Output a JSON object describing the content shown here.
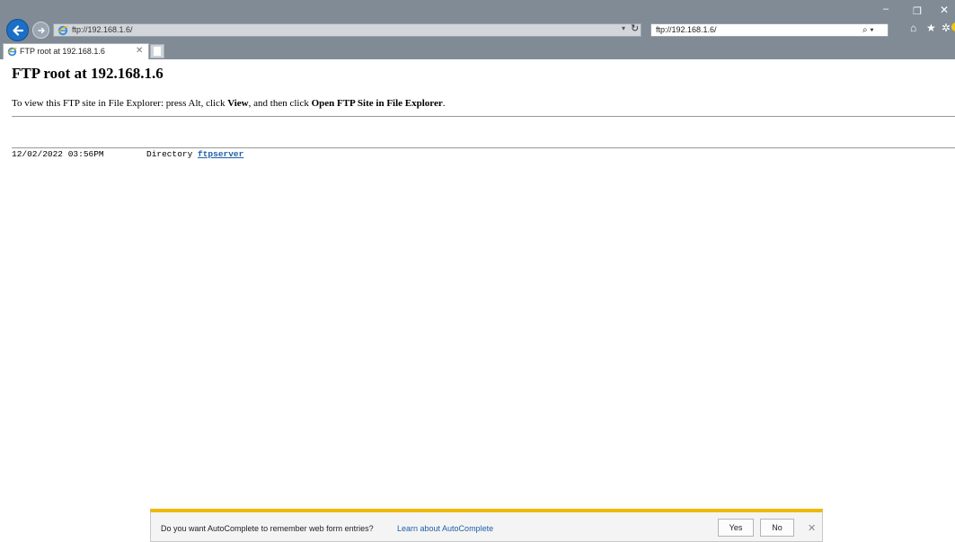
{
  "window": {
    "minimize_glyph": "–",
    "restore_glyph": "❐",
    "close_glyph": "✕"
  },
  "toolbar": {
    "address_url": "ftp://192.168.1.6/",
    "secondary_url": "ftp://192.168.1.6/",
    "search_glyph": "⌕ ▾",
    "dropdown_glyph": "▾",
    "refresh_glyph": "↻",
    "icons": [
      "back-icon",
      "forward-icon",
      "home-icon",
      "star-icon",
      "gear-icon",
      "smiley-icon"
    ],
    "home_glyph": "⌂",
    "star_glyph": "★",
    "gear_glyph": "✲"
  },
  "tab": {
    "title": "FTP root at 192.168.1.6",
    "close_glyph": "✕"
  },
  "page": {
    "title": "FTP root at 192.168.1.6",
    "instructions": {
      "part1": "To view this FTP site in File Explorer: press Alt, click ",
      "view": "View",
      "part2": ", and then click ",
      "open": "Open FTP Site in File Explorer",
      "part3": "."
    },
    "listing": [
      {
        "date": "12/02/2022 03:56PM",
        "type": "Directory",
        "name": "ftpserver"
      }
    ]
  },
  "autocomplete": {
    "question": "Do you want AutoComplete to remember web form entries?",
    "link": "Learn about AutoComplete",
    "yes_label": "Yes",
    "no_label": "No",
    "close_glyph": "✕"
  },
  "colors": {
    "chrome": "#808b96",
    "accent_blue": "#1b6fc6",
    "link": "#1f5fa8",
    "notif_border": "#f0b800"
  }
}
